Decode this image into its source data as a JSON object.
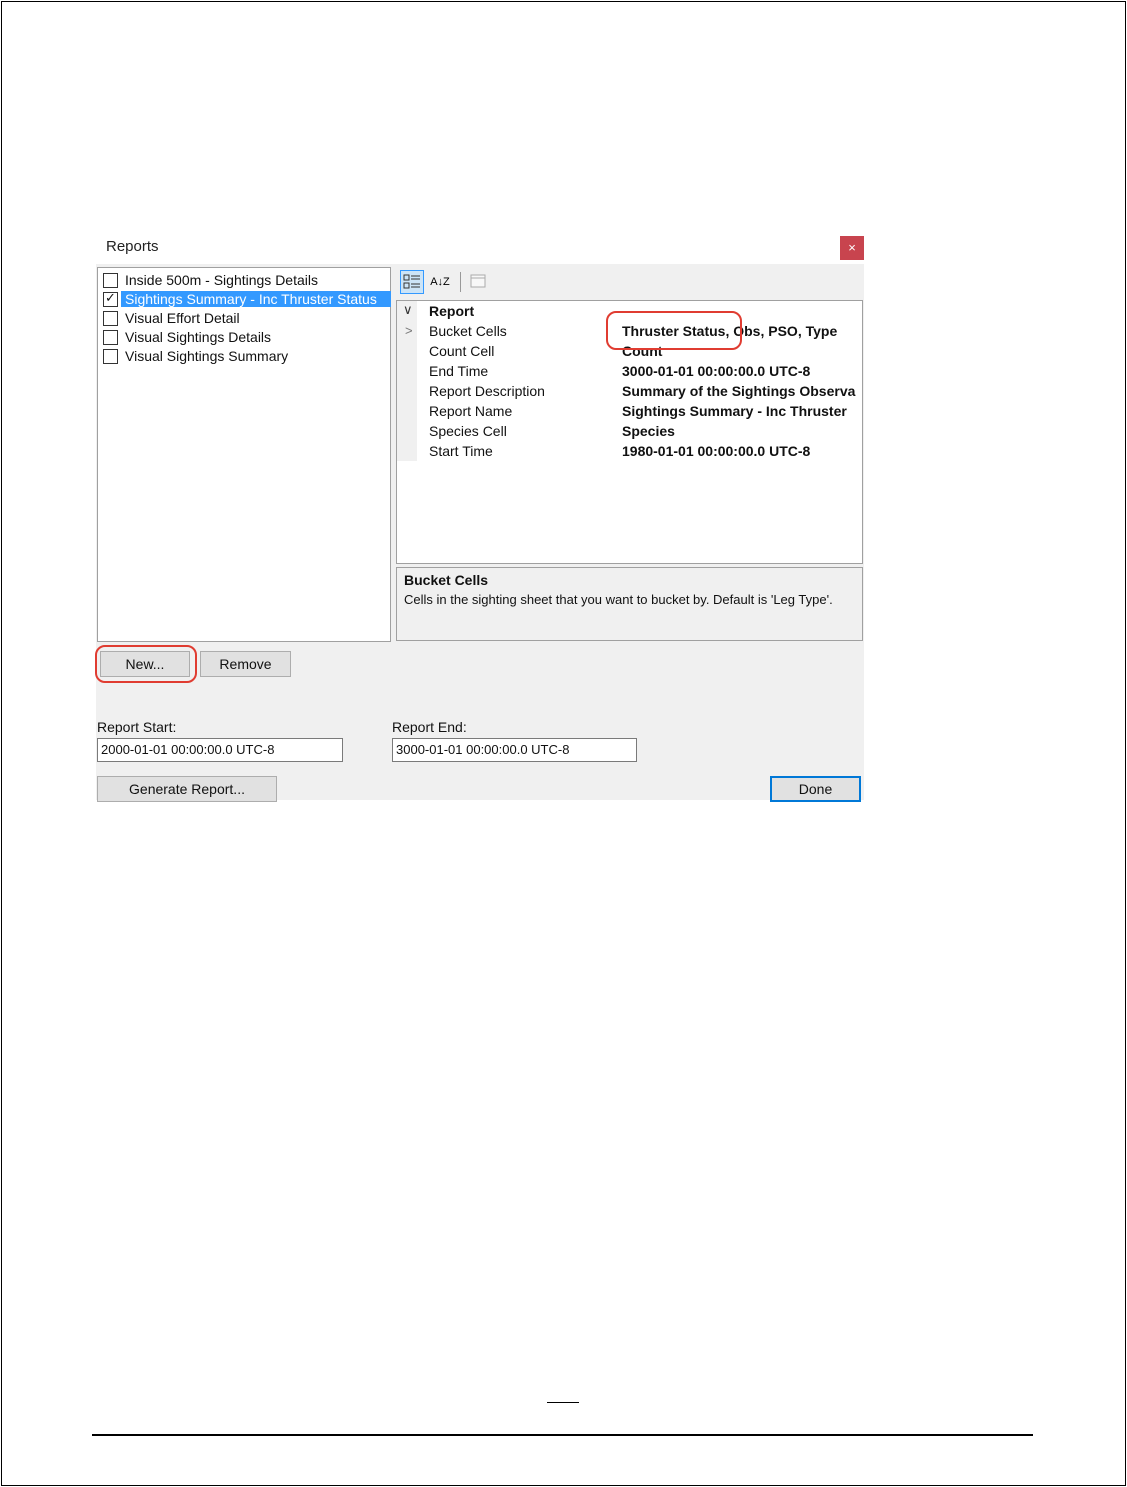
{
  "dialog": {
    "title": "Reports",
    "close_label": "×"
  },
  "report_list": {
    "items": [
      {
        "label": "Inside 500m - Sightings Details",
        "checked": false
      },
      {
        "label": "Sightings Summary - Inc Thruster Status",
        "checked": true
      },
      {
        "label": "Visual Effort Detail",
        "checked": false
      },
      {
        "label": "Visual Sightings Details",
        "checked": false
      },
      {
        "label": "Visual Sightings Summary",
        "checked": false
      }
    ],
    "selected_index": 1
  },
  "toolbar": {
    "categorized_icon": "categorized-view-icon",
    "alpha_icon": "alphabetical-sort-icon",
    "pages_icon": "property-pages-icon",
    "alpha_glyph": "A↓Z"
  },
  "property_grid": {
    "category": "Report",
    "rows": [
      {
        "name": "Bucket Cells",
        "value": "Thruster Status, Obs, PSO, Type",
        "expandable": true
      },
      {
        "name": "Count Cell",
        "value": "Count",
        "expandable": false
      },
      {
        "name": "End Time",
        "value": "3000-01-01 00:00:00.0 UTC-8",
        "expandable": false
      },
      {
        "name": "Report Description",
        "value": "Summary of the Sightings Observa",
        "expandable": false
      },
      {
        "name": "Report Name",
        "value": "Sightings Summary - Inc Thruster",
        "expandable": false
      },
      {
        "name": "Species Cell",
        "value": "Species",
        "expandable": false
      },
      {
        "name": "Start Time",
        "value": "1980-01-01 00:00:00.0 UTC-8",
        "expandable": false
      }
    ]
  },
  "help": {
    "title": "Bucket Cells",
    "description": "Cells in the sighting sheet that you want to bucket by. Default is 'Leg Type'."
  },
  "buttons": {
    "new_label": "New...",
    "remove_label": "Remove",
    "generate_label": "Generate Report...",
    "done_label": "Done"
  },
  "report_start": {
    "label": "Report Start:",
    "value": "2000-01-01 00:00:00.0 UTC-8"
  },
  "report_end": {
    "label": "Report End:",
    "value": "3000-01-01 00:00:00.0 UTC-8"
  },
  "colors": {
    "selection": "#3399ff",
    "close": "#c8444e",
    "highlight": "#e03c31"
  }
}
